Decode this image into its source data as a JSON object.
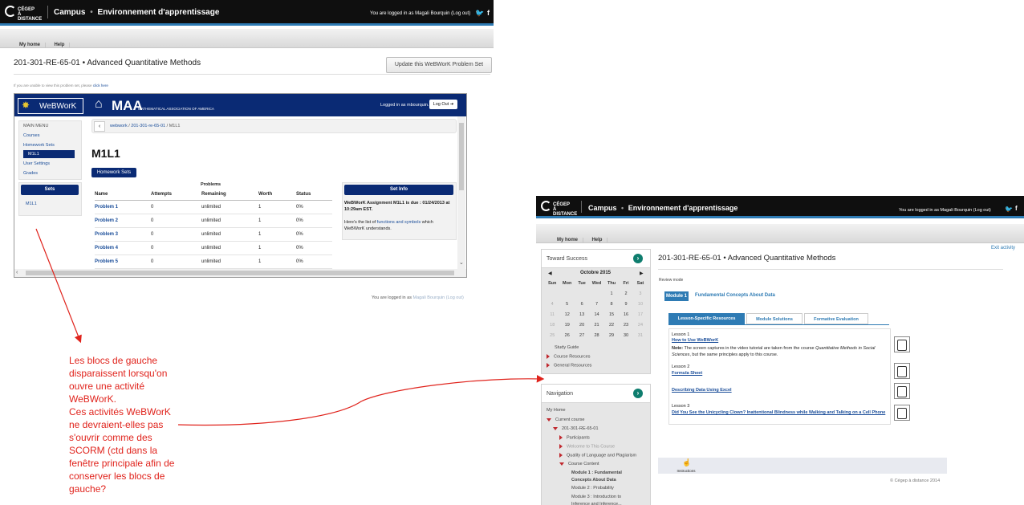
{
  "left_window": {
    "brand": {
      "logo_line1": "CÉGEP",
      "logo_line2": "À DISTANCE",
      "campus": "Campus",
      "sep": "•",
      "env": "Environnement d'apprentissage"
    },
    "logged_in": "You are logged in as Magali Bourquin (Log out)",
    "nav": {
      "my_home": "My home",
      "help": "Help"
    },
    "course_title": "201-301-RE-65-01 • Advanced Quantitative Methods",
    "update_button": "Update this WeBWorK Problem Set",
    "cant_view": "If you are unable to view this problem set, please",
    "click_here": "click here",
    "footer_logged": "You are logged in as",
    "footer_user": "Magali Bourquin",
    "footer_logout": "(Log out)",
    "webwork": {
      "brand": "WeBWorK",
      "maa": "MAA",
      "maa_sub": "MATHEMATICAL ASSOCIATION OF AMERICA",
      "logged_in_as": "Logged in as mbourquin.",
      "logout": "Log Out",
      "main_menu": "MAIN MENU",
      "menu_items": [
        "Courses",
        "Homework Sets",
        "M1L1",
        "User Settings",
        "Grades"
      ],
      "sets_label": "Sets",
      "sets_item": "M1L1",
      "breadcrumb": {
        "a": "webwork",
        "sep": "/",
        "b": "201-301-re-65-01",
        "c": "M1L1"
      },
      "page_title": "M1L1",
      "homework_sets_btn": "Homework Sets",
      "problems_caption": "Problems",
      "headers": [
        "Name",
        "Attempts",
        "Remaining",
        "Worth",
        "Status"
      ],
      "rows": [
        [
          "Problem 1",
          "0",
          "unlimited",
          "1",
          "0%"
        ],
        [
          "Problem 2",
          "0",
          "unlimited",
          "1",
          "0%"
        ],
        [
          "Problem 3",
          "0",
          "unlimited",
          "1",
          "0%"
        ],
        [
          "Problem 4",
          "0",
          "unlimited",
          "1",
          "0%"
        ],
        [
          "Problem 5",
          "0",
          "unlimited",
          "1",
          "0%"
        ]
      ],
      "set_info_title": "Set Info",
      "set_info_due": "WeBWorK Assignment M1L1 is due : 01/24/2013 at 10:29am EST.",
      "set_info_text_a": "Here's the list of",
      "set_info_link": "functions and symbols",
      "set_info_text_b": "which WeBWorK understands."
    }
  },
  "annotation": "Les blocs de gauche disparaissent lorsqu'on ouvre une activité WeBWorK.\nCes activités WeBWorK ne devraient-elles pas s'ouvrir comme des SCORM (ctd dans la fenêtre principale afin de conserver les blocs de gauche?",
  "right_window": {
    "brand": {
      "logo_line1": "CÉGEP",
      "logo_line2": "À DISTANCE",
      "campus": "Campus",
      "sep": "•",
      "env": "Environnement d'apprentissage"
    },
    "logged_in": "You are logged in as Magali Bourquin (Log out)",
    "nav": {
      "my_home": "My home",
      "help": "Help"
    },
    "exit_activity": "Exit activity",
    "toward_success": "Toward Success",
    "calendar": {
      "month": "Octobre 2015",
      "days": [
        "Sun",
        "Mon",
        "Tue",
        "Wed",
        "Thu",
        "Fri",
        "Sat"
      ],
      "weeks": [
        [
          "",
          "",
          "",
          "",
          "1",
          "2",
          "3"
        ],
        [
          "4",
          "5",
          "6",
          "7",
          "8",
          "9",
          "10"
        ],
        [
          "11",
          "12",
          "13",
          "14",
          "15",
          "16",
          "17"
        ],
        [
          "18",
          "19",
          "20",
          "21",
          "22",
          "23",
          "24"
        ],
        [
          "25",
          "26",
          "27",
          "28",
          "29",
          "30",
          "31"
        ]
      ]
    },
    "study_guide": "Study Guide",
    "course_resources": "Course Resources",
    "general_resources": "General Resources",
    "navigation": "Navigation",
    "nav_tree": {
      "my_home": "My Home",
      "current_course": "Current course",
      "course_code": "201-301-RE-65-01",
      "participants": "Participants",
      "welcome": "Welcome to This Course",
      "quality": "Quality of Language and Plagiarism",
      "course_content": "Course Content",
      "module1": "Module 1 : Fundamental Concepts About Data",
      "module2": "Module 2 : Probability",
      "module3": "Module 3 : Introduction to Inference and Inference..."
    },
    "course_title": "201-301-RE-65-01 • Advanced Quantitative Methods",
    "review_mode": "Review mode",
    "module_badge": "Module 1",
    "module_title": "Fundamental Concepts About Data",
    "tabs": [
      "Lesson-Specific Resources",
      "Module Solutions",
      "Formative Evaluation"
    ],
    "lesson1": "Lesson 1",
    "how_to_use": "How to Use WeBWorK",
    "note_label": "Note:",
    "note_text_a": "The screen captures in the video tutorial are taken from the course",
    "note_course": "Quantitative Methods in Social Sciences",
    "note_text_b": ", but the same principles apply to this course.",
    "lesson2": "Lesson 2",
    "formula_sheet": "Formula Sheet",
    "describing": "Describing Data Using Excel",
    "lesson3": "Lesson 3",
    "unicycling": "Did You See the Unicycling Clown? Inattentional Blindness while Walking and Talking on a Cell Phone",
    "instructions": "Instructions",
    "copyright": "© Cégep à distance 2014"
  }
}
